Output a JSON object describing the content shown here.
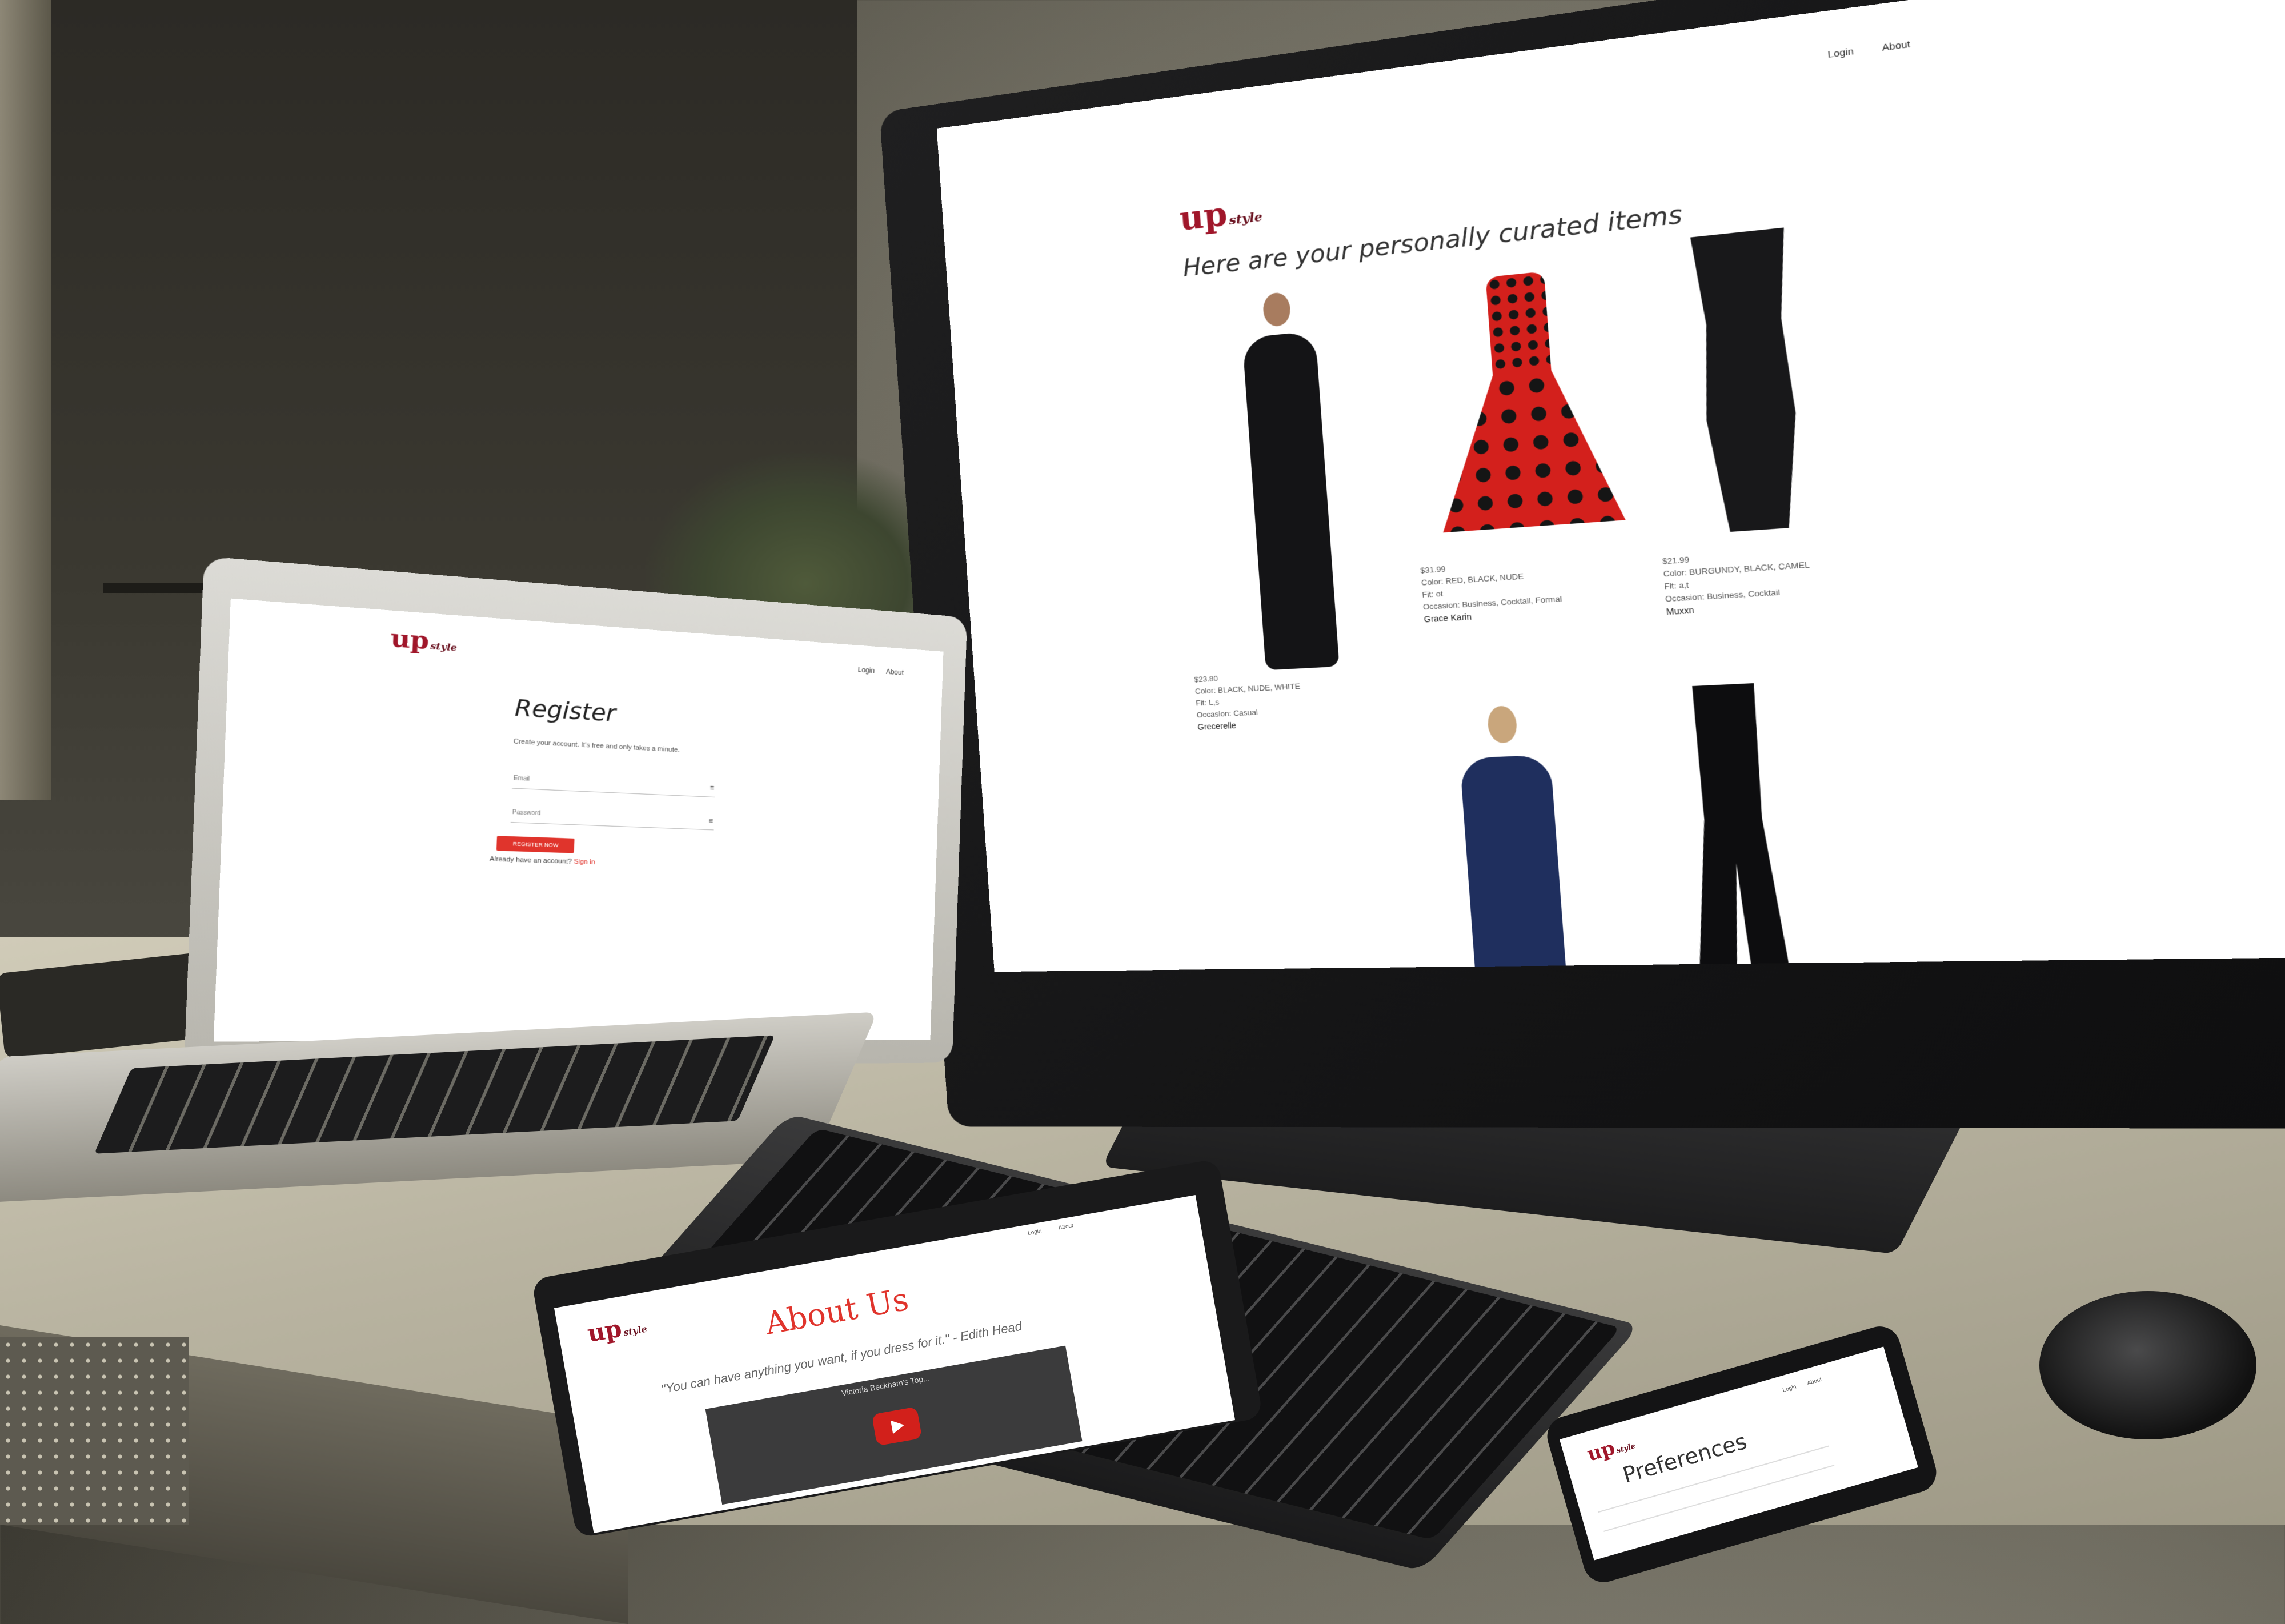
{
  "monitor_site": {
    "nav": {
      "login": "Login",
      "about": "About"
    },
    "logo": {
      "main": "up",
      "small": "style"
    },
    "heading": "Here are your personally curated items",
    "products": [
      {
        "price": "$23.80",
        "color": "Color: BLACK, NUDE, WHITE",
        "fit": "Fit: L,s",
        "occasion": "Occasion: Casual",
        "brand": "Grecerelle",
        "icon": "maxi-dress-black"
      },
      {
        "price": "$31.99",
        "color": "Color: RED, BLACK, NUDE",
        "fit": "Fit: ot",
        "occasion": "Occasion: Business, Cocktail, Formal",
        "brand": "Grace Karin",
        "icon": "polka-dot-dress-red"
      },
      {
        "price": "$21.99",
        "color": "Color: BURGUNDY, BLACK, CAMEL",
        "fit": "Fit: a,t",
        "occasion": "Occasion: Business, Cocktail",
        "brand": "Muxxn",
        "icon": "sheath-dress-black"
      },
      {
        "price": "",
        "color": "",
        "fit": "",
        "occasion": "",
        "brand": "",
        "icon": "maxi-dress-navy"
      },
      {
        "price": "",
        "color": "",
        "fit": "",
        "occasion": "",
        "brand": "",
        "icon": "jumpsuit-black"
      }
    ]
  },
  "laptop_site": {
    "nav": {
      "login": "Login",
      "about": "About"
    },
    "logo": {
      "main": "up",
      "small": "style"
    },
    "title": "Register",
    "subtitle": "Create your account. It's free and only takes a minute.",
    "email_placeholder": "Email",
    "password_placeholder": "Password",
    "register_button": "REGISTER NOW",
    "already_text": "Already have an account?",
    "signin_link": "Sign in"
  },
  "tablet_site": {
    "nav": {
      "login": "Login",
      "about": "About"
    },
    "logo": {
      "main": "up",
      "small": "style"
    },
    "title": "About Us",
    "quote": "\"You can have anything you want, if you dress for it.\" - Edith Head",
    "video_title": "Victoria Beckham's Top..."
  },
  "phone_site": {
    "nav": {
      "login": "Login",
      "about": "About"
    },
    "logo": {
      "main": "up",
      "small": "style"
    },
    "title": "Preferences"
  },
  "colors": {
    "brand_red": "#a0162a",
    "accent_red": "#e0342c"
  }
}
